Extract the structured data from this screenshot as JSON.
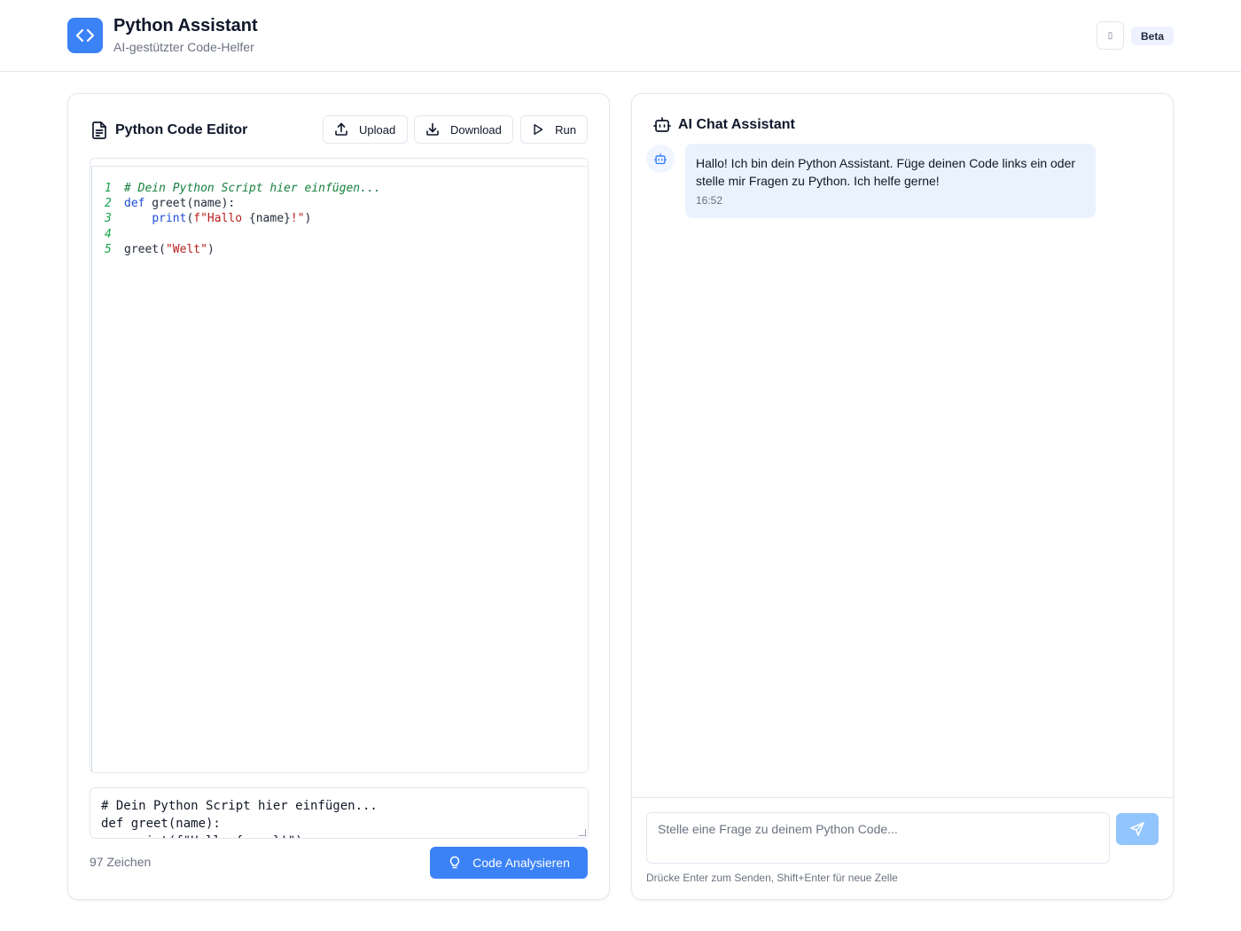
{
  "header": {
    "title": "Python Assistant",
    "subtitle": "AI-gestützter Code-Helfer",
    "theme_toggle_glyph": "▯",
    "badge": "Beta",
    "logo_icon": "code-brackets-icon",
    "brand_color": "#3b82f6"
  },
  "editor": {
    "title": "Python Code Editor",
    "upload_label": "Upload",
    "download_label": "Download",
    "run_label": "Run",
    "code_lines": [
      {
        "num": "1",
        "tokens": [
          {
            "t": "# Dein Python Script hier einfügen...",
            "k": "comment"
          }
        ]
      },
      {
        "num": "2",
        "tokens": [
          {
            "t": "def",
            "k": "kw"
          },
          {
            "t": " greet(name):",
            "k": "plain"
          }
        ]
      },
      {
        "num": "3",
        "tokens": [
          {
            "t": "    ",
            "k": "plain"
          },
          {
            "t": "print",
            "k": "kw"
          },
          {
            "t": "(",
            "k": "plain"
          },
          {
            "t": "f\"Hallo ",
            "k": "str"
          },
          {
            "t": "{name}",
            "k": "plain"
          },
          {
            "t": "!\"",
            "k": "str"
          },
          {
            "t": ")",
            "k": "plain"
          }
        ]
      },
      {
        "num": "4",
        "tokens": []
      },
      {
        "num": "5",
        "tokens": [
          {
            "t": "greet(",
            "k": "plain"
          },
          {
            "t": "\"Welt\"",
            "k": "str"
          },
          {
            "t": ")",
            "k": "plain"
          }
        ]
      }
    ],
    "raw_lines": [
      "# Dein Python Script hier einfügen...",
      "def greet(name):",
      "    print(f\"Hallo {name}!\")"
    ],
    "char_count": "97 Zeichen",
    "analyze_label": "Code Analysieren"
  },
  "chat": {
    "title": "AI Chat Assistant",
    "messages": [
      {
        "sender": "bot",
        "text": "Hallo! Ich bin dein Python Assistant. Füge deinen Code links ein oder stelle mir Fragen zu Python. Ich helfe gerne!",
        "time": "16:52"
      }
    ],
    "input_placeholder": "Stelle eine Frage zu deinem Python Code...",
    "hint": "Drücke Enter zum Senden, Shift+Enter für neue Zelle",
    "send_icon": "send-icon"
  }
}
